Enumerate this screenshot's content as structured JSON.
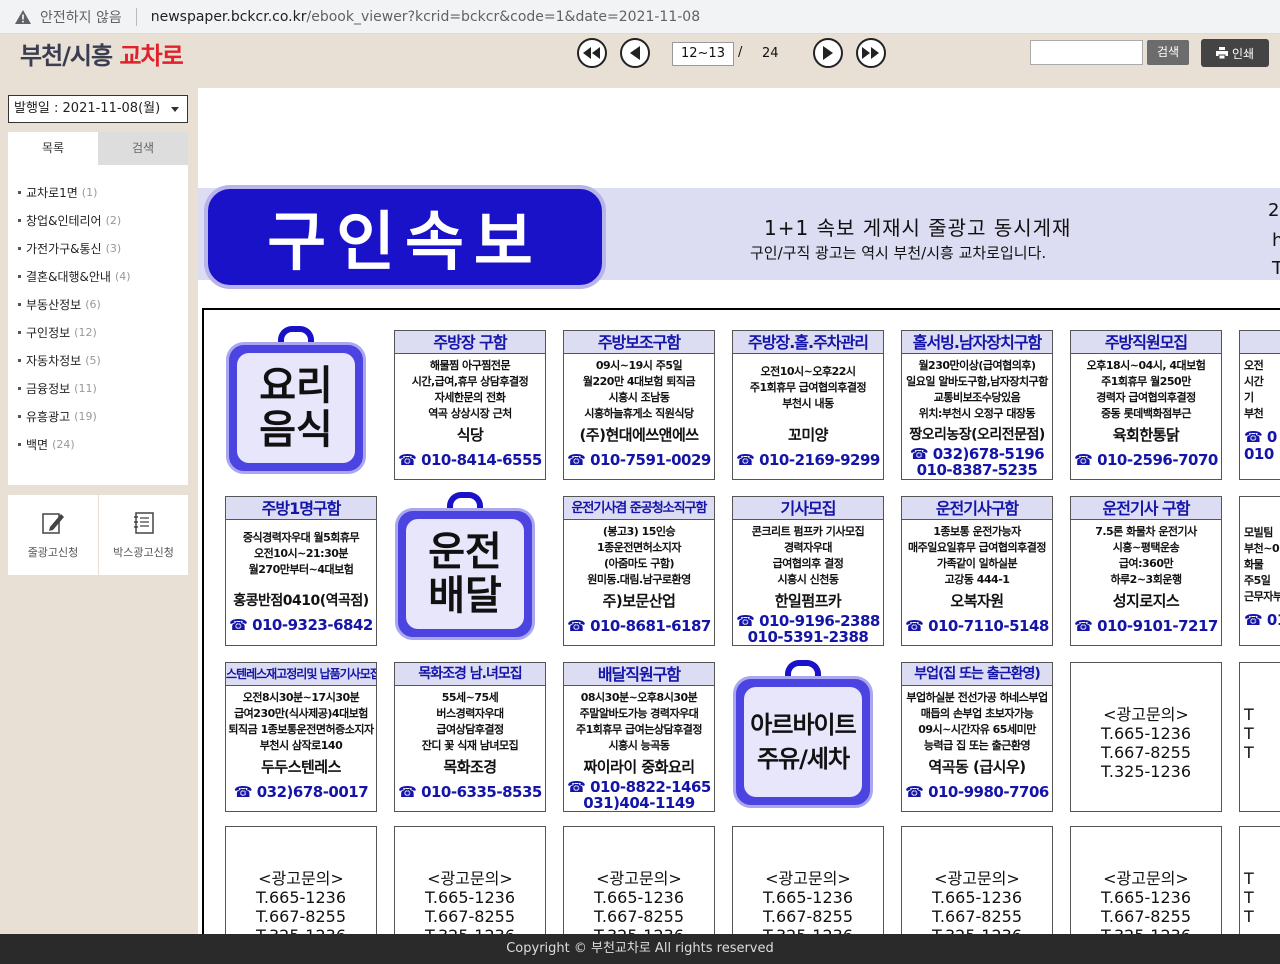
{
  "browser": {
    "security_label": "안전하지 않음",
    "url_host": "newspaper.bckcr.co.kr",
    "url_path": "/ebook_viewer?kcrid=bckcr&code=1&date=2021-11-08"
  },
  "header": {
    "logo_left": "부천/시흥 ",
    "logo_right": "교차로",
    "page_current": "12~13",
    "page_sep": "/",
    "page_total": "24",
    "search_placeholder": "",
    "search_label": "검색",
    "print_label": "인쇄"
  },
  "sidebar": {
    "date_label": "발행일 : 2021-11-08(월)",
    "tab_contents": "목록",
    "tab_search": "검색",
    "categories": [
      {
        "label": "교차로1면",
        "count": "(1)"
      },
      {
        "label": "창업&인테리어",
        "count": "(2)"
      },
      {
        "label": "가전가구&통신",
        "count": "(3)"
      },
      {
        "label": "결혼&대행&안내",
        "count": "(4)"
      },
      {
        "label": "부동산정보",
        "count": "(6)"
      },
      {
        "label": "구인정보",
        "count": "(12)"
      },
      {
        "label": "자동차정보",
        "count": "(5)"
      },
      {
        "label": "금융정보",
        "count": "(11)"
      },
      {
        "label": "유흥광고",
        "count": "(19)"
      },
      {
        "label": "백면",
        "count": "(24)"
      }
    ],
    "line_ad_label": "줄광고신청",
    "box_ad_label": "박스광고신청"
  },
  "banner": {
    "title": "구인속보",
    "line1": "1+1 속보 게재시 줄광고 동시게재",
    "line2": "구인/구직 광고는 역시 부천/시흥 교차로입니다.",
    "edge1": "2",
    "edge2": "h",
    "edge3": "T"
  },
  "tags": {
    "food_1": "요리",
    "food_2": "음식",
    "drive_1": "운전",
    "drive_2": "배달",
    "parttime_1": "아르바이트",
    "parttime_2": "주유/세차"
  },
  "ads": [
    {
      "title": "주방장 구함",
      "body": [
        "해물찜 아구찜전문",
        "시간,급여,휴무 상담후결정",
        "자세한문의 전화",
        "역곡 상상시장 근처"
      ],
      "company": "식당",
      "phone": "☎ 010-8414-6555"
    },
    {
      "title": "주방보조구함",
      "body": [
        "09시~19시 주5일",
        "월220만 4대보험 퇴직금",
        "시흥시 조남동",
        "시흥하늘휴게소 직원식당"
      ],
      "company": "(주)현대에쓰앤에쓰",
      "phone": "☎ 010-7591-0029"
    },
    {
      "title": "주방장.홀.주차관리",
      "body": [
        "오전10시~오후22시",
        "주1회휴무 급여협의후결정",
        "부천시 내동"
      ],
      "company": "꼬미양",
      "phone": "☎ 010-2169-9299"
    },
    {
      "title": "홀서빙.남자장치구함",
      "body": [
        "월230만이상(급여협의후)",
        "일요일 알바도구함,남자장치구함",
        "교통비보조수당있음",
        "위치:부천시 오정구 대장동"
      ],
      "company": "짱오리농장(오리전문점)",
      "phone": "☎ 032)678-5196",
      "phone2": "010-8387-5235"
    },
    {
      "title": "주방직원모집",
      "body": [
        "오후18시~04시, 4대보험",
        "주1회휴무 월250만",
        "경력자 급여협의후결정",
        "중동 롯데백화점부근"
      ],
      "company": "육회한통닭",
      "phone": "☎ 010-2596-7070"
    },
    {
      "title": "주방1명구함",
      "body": [
        "중식경력자우대 월5회휴무",
        "오전10시~21:30분",
        "월270만부터~4대보험"
      ],
      "company": "홍콩반점0410(역곡점)",
      "phone": "☎ 010-9323-6842"
    },
    {
      "title": "운전기사겸 준공청소직구함",
      "body": [
        "(봉고3) 15인승",
        "1종운전면허소지자",
        "(아줌마도 구함)",
        "원미동.대림.남구로환영"
      ],
      "company": "주)보문산업",
      "phone": "☎ 010-8681-6187"
    },
    {
      "title": "기사모집",
      "body": [
        "콘크리트 펌프카 기사모집",
        "경력자우대",
        "급여협의후 결정",
        "시흥시 신천동"
      ],
      "company": "한일펌프카",
      "phone": "☎ 010-9196-2388",
      "phone2": "010-5391-2388"
    },
    {
      "title": "운전기사구함",
      "body": [
        "1종보통 운전가능자",
        "매주일요일휴무 급여협의후결정",
        "가족같이 일하실분",
        "고강동 444-1"
      ],
      "company": "오복자원",
      "phone": "☎ 010-7110-5148"
    },
    {
      "title": "운전기사 구함",
      "body": [
        "7.5론 화물차 운전기사",
        "시흥~평택운송",
        "급여:360만",
        "하루2~3회운행"
      ],
      "company": "성지로지스",
      "phone": "☎ 010-9101-7217"
    },
    {
      "title": "스텐레스재고정리및 납품기사모집",
      "body": [
        "오전8시30분~17시30분",
        "급여230만(식사제공)4대보험",
        "퇴직금 1종보통운전면허증소지자",
        "부천시 삼작로140"
      ],
      "company": "두두스텐레스",
      "phone": "☎ 032)678-0017"
    },
    {
      "title": "목화조경 남.녀모집",
      "body": [
        "55세~75세",
        "버스경력자우대",
        "급여상담후결정",
        "잔디 꽃 식재 남녀모집"
      ],
      "company": "목화조경",
      "phone": "☎ 010-6335-8535"
    },
    {
      "title": "배달직원구함",
      "body": [
        "08시30분~오후8시30분",
        "주말알바도가능 경력자우대",
        "주1회휴무 급여는상담후결정",
        "시흥시 능곡동"
      ],
      "company": "짜이라이 중화요리",
      "phone": "☎ 010-8822-1465",
      "phone2": "031)404-1149"
    },
    {
      "title": "부업(집 또는 출근환영)",
      "body": [
        "부업하실분 전선가공 하네스부업",
        "매듭의 손부업 초보자가능",
        "09시~시간자유 65세미만",
        "능력급 집 또는 출근환영"
      ],
      "company": "역곡동 (급시우)",
      "phone": "☎ 010-9980-7706"
    }
  ],
  "inquiry": {
    "heading": "<광고문의>",
    "l1": "T.665-1236",
    "l2": "T.667-8255",
    "l3": "T.325-1236"
  },
  "edge": {
    "a": "오전",
    "b": "시간",
    "c": "기",
    "d": "부천",
    "e": "☎ 0",
    "f": "010",
    "g": "모빌팀",
    "h": "부천~0",
    "i": "화물",
    "j": "주5일",
    "k": "근무자부",
    "l": "☎ 01",
    "m": "T",
    "n": "T",
    "o": "T"
  },
  "footer": {
    "text": "Copyright © 부천교차로 All rights reserved"
  }
}
